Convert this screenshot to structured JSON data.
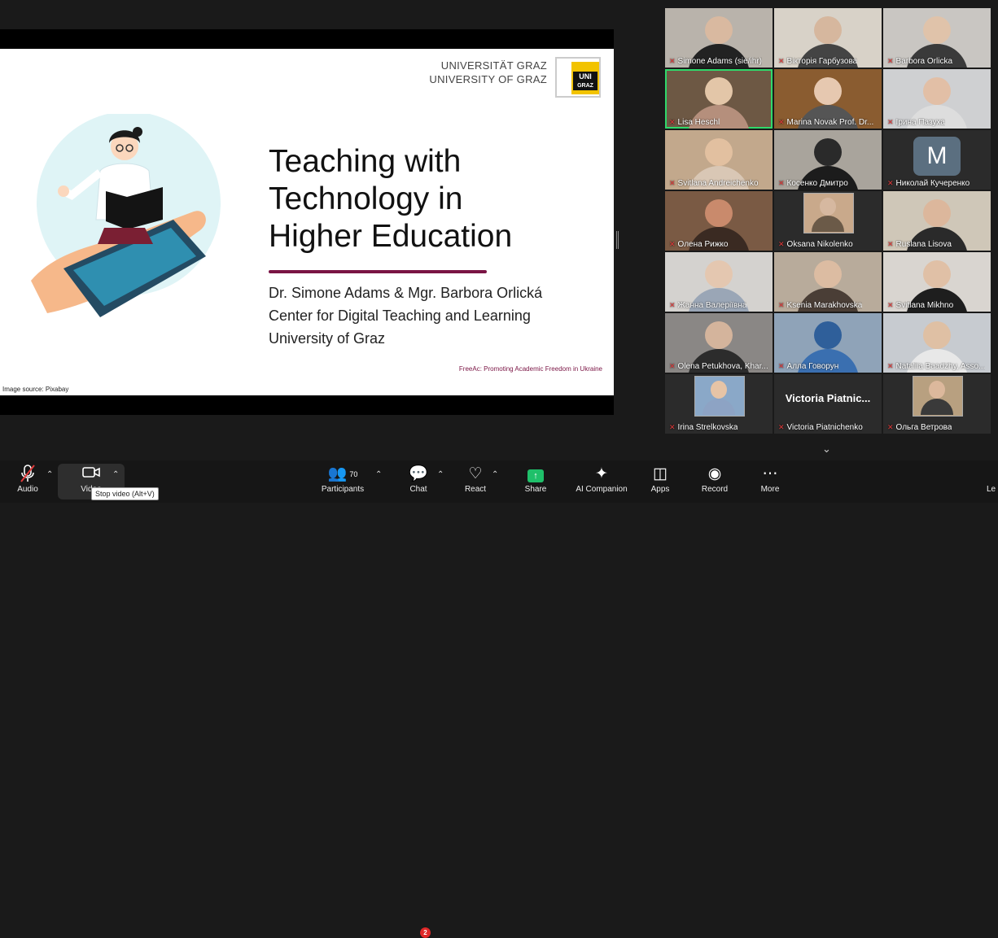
{
  "slide": {
    "uni_line1": "UNIVERSITÄT GRAZ",
    "uni_line2": "UNIVERSITY OF GRAZ",
    "logo_text1": "UNI",
    "logo_text2": "GRAZ",
    "title_line1": "Teaching with",
    "title_line2": "Technology in",
    "title_line3": "Higher Education",
    "subtitle1": "Dr. Simone Adams & Mgr. Barbora Orlická",
    "subtitle2": "Center for Digital Teaching and Learning",
    "subtitle3": "University of Graz",
    "footer_note": "FreeAc: Promoting Academic Freedom in Ukraine",
    "image_source": "Image source: Pixabay"
  },
  "gallery": {
    "tiles": [
      {
        "name": "Simone Adams (sie/ihr)",
        "bg": "#b9b3ab",
        "skin": "#d9b9a0",
        "shirt": "#222"
      },
      {
        "name": "Вікторія Гарбузова",
        "bg": "#d8d2c8",
        "skin": "#d6b79e",
        "shirt": "#444"
      },
      {
        "name": "Barbora Orlicka",
        "bg": "#c9c6c2",
        "skin": "#e0c3aa",
        "shirt": "#3a3a3a"
      },
      {
        "name": "Lisa Heschl",
        "bg": "#6d5844",
        "skin": "#e3c6a8",
        "shirt": "#b58f7c"
      },
      {
        "name": "Marina Novak Prof. Dr...",
        "bg": "#8a5c30",
        "skin": "#e6c8b0",
        "shirt": "#555"
      },
      {
        "name": "Ірина Пазуха",
        "bg": "#cfd0d2",
        "skin": "#e2bfa6",
        "shirt": "#ddd"
      },
      {
        "name": "Svitlana Andreichenko",
        "bg": "#c2a88c",
        "skin": "#e2c0a0",
        "shirt": "#d9c7b5"
      },
      {
        "name": "Косенко Дмитро",
        "bg": "#a9a49c",
        "skin": "#2a2a2a",
        "shirt": "#1c1c1c"
      },
      {
        "name": "Николай Кучеренко",
        "bg": "#2b2b2b",
        "skin": "",
        "shirt": "",
        "avatar": "M"
      },
      {
        "name": "Олена Рижко",
        "bg": "#7a5a44",
        "skin": "#c98a6c",
        "shirt": "#3a2a22"
      },
      {
        "name": "Oksana Nikolenko",
        "bg": "#2b2b2b",
        "skin": "#d6b8a0",
        "shirt": "#6b5a48",
        "thumb": "#c9a98b"
      },
      {
        "name": "Ruslana Lisova",
        "bg": "#cfc7b8",
        "skin": "#dcb79c",
        "shirt": "#2a2a2a"
      },
      {
        "name": "Жанна Валеріївна",
        "bg": "#d4d2cf",
        "skin": "#e4c7b0",
        "shirt": "#9aa6b6"
      },
      {
        "name": "Ksenia Marakhovska",
        "bg": "#b8ab9b",
        "skin": "#dcbca2",
        "shirt": "#4a3e36"
      },
      {
        "name": "Svitlana Mikhno",
        "bg": "#d9d5d0",
        "skin": "#e0c0a6",
        "shirt": "#1e1e1e"
      },
      {
        "name": "Olena Petukhova, Khar...",
        "bg": "#8a8785",
        "skin": "#d4b49c",
        "shirt": "#2c2c2c"
      },
      {
        "name": "Алла Говорун",
        "bg": "#8fa3b8",
        "skin": "#2f5f9a",
        "shirt": "#3a6fb0"
      },
      {
        "name": "Nataliia Baadzhy, Asso...",
        "bg": "#c7cbd0",
        "skin": "#dfc0a4",
        "shirt": "#e8e8e8"
      },
      {
        "name": "Irina Strelkovska",
        "bg": "#2b2b2b",
        "skin": "#e6c4a6",
        "shirt": "#8da3c4",
        "thumb": "#8aa8c8"
      },
      {
        "name": "Victoria Piatnichenko",
        "bg": "#2b2b2b",
        "skin": "",
        "shirt": "",
        "bigname": "Victoria  Piatnic..."
      },
      {
        "name": "Ольга Ветрова",
        "bg": "#2b2b2b",
        "skin": "#dcb89c",
        "shirt": "#3a3a3a",
        "thumb": "#b8a080"
      }
    ]
  },
  "toolbar": {
    "audio": "Audio",
    "video": "Video",
    "video_tooltip": "Stop video (Alt+V)",
    "participants": "Participants",
    "participants_count": "70",
    "chat": "Chat",
    "chat_badge": "2",
    "react": "React",
    "share": "Share",
    "ai_companion": "AI Companion",
    "apps": "Apps",
    "record": "Record",
    "more": "More",
    "leave": "Le"
  }
}
